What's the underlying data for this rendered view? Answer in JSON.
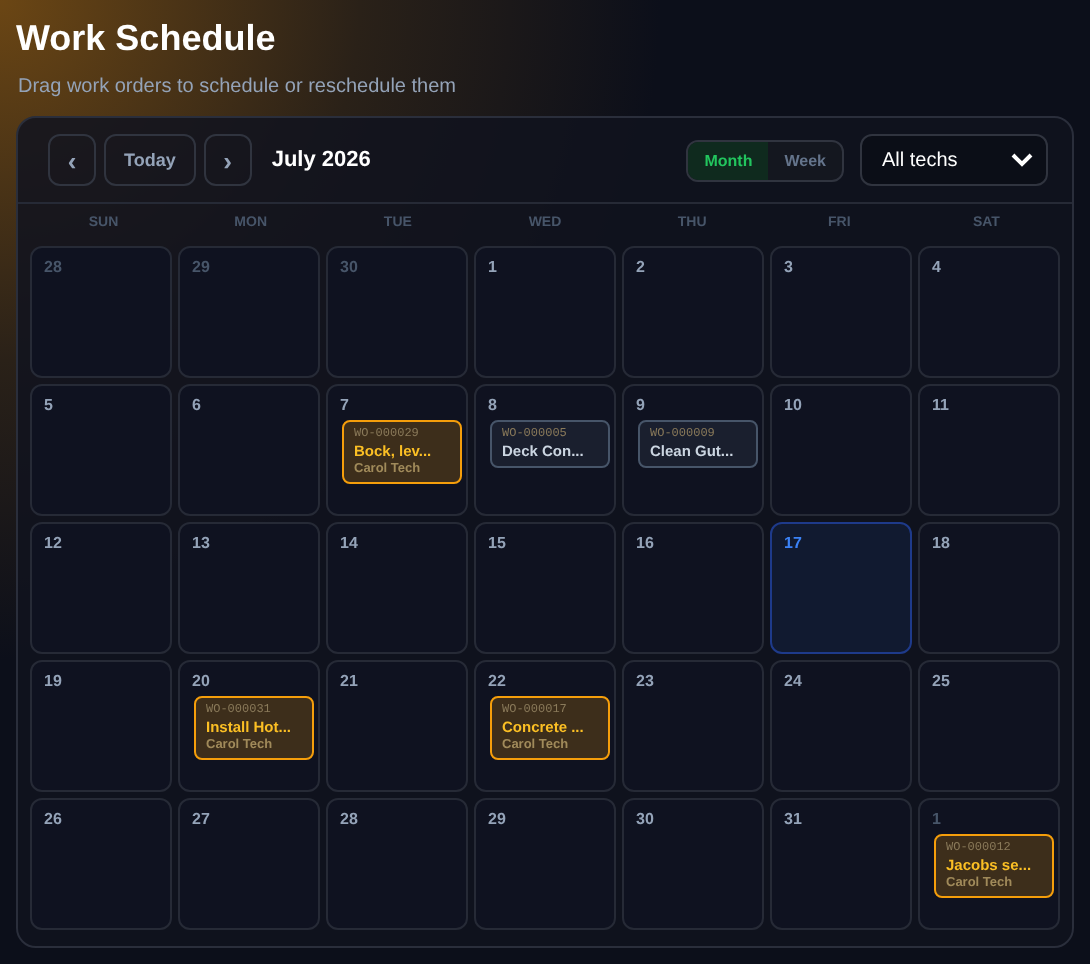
{
  "title": "Work Schedule",
  "subtitle": "Drag work orders to schedule or reschedule them",
  "toolbar": {
    "prev": "‹",
    "today": "Today",
    "next": "›",
    "month_label": "July 2026",
    "views": [
      {
        "label": "Month",
        "selected": true
      },
      {
        "label": "Week",
        "selected": false
      }
    ],
    "tech_filter": "All techs"
  },
  "weekdays": [
    "SUN",
    "MON",
    "TUE",
    "WED",
    "THU",
    "FRI",
    "SAT"
  ],
  "days": [
    {
      "day": "28",
      "outside": true,
      "today": false
    },
    {
      "day": "29",
      "outside": true,
      "today": false
    },
    {
      "day": "30",
      "outside": true,
      "today": false
    },
    {
      "day": "1",
      "outside": false,
      "today": false
    },
    {
      "day": "2",
      "outside": false,
      "today": false
    },
    {
      "day": "3",
      "outside": false,
      "today": false
    },
    {
      "day": "4",
      "outside": false,
      "today": false
    },
    {
      "day": "5",
      "outside": false,
      "today": false
    },
    {
      "day": "6",
      "outside": false,
      "today": false
    },
    {
      "day": "7",
      "outside": false,
      "today": false,
      "events": [
        {
          "id": "WO-000029",
          "title": "Bock, lev...",
          "tech": "Carol Tech",
          "color": "#f59e0b"
        }
      ]
    },
    {
      "day": "8",
      "outside": false,
      "today": false,
      "events": [
        {
          "id": "WO-000005",
          "title": "Deck Con...",
          "color": "#475569"
        }
      ]
    },
    {
      "day": "9",
      "outside": false,
      "today": false,
      "events": [
        {
          "id": "WO-000009",
          "title": "Clean Gut...",
          "color": "#475569"
        }
      ]
    },
    {
      "day": "10",
      "outside": false,
      "today": false
    },
    {
      "day": "11",
      "outside": false,
      "today": false
    },
    {
      "day": "12",
      "outside": false,
      "today": false
    },
    {
      "day": "13",
      "outside": false,
      "today": false
    },
    {
      "day": "14",
      "outside": false,
      "today": false
    },
    {
      "day": "15",
      "outside": false,
      "today": false
    },
    {
      "day": "16",
      "outside": false,
      "today": false
    },
    {
      "day": "17",
      "outside": false,
      "today": true
    },
    {
      "day": "18",
      "outside": false,
      "today": false
    },
    {
      "day": "19",
      "outside": false,
      "today": false
    },
    {
      "day": "20",
      "outside": false,
      "today": false,
      "events": [
        {
          "id": "WO-000031",
          "title": "Install Hot...",
          "tech": "Carol Tech",
          "color": "#f59e0b"
        }
      ]
    },
    {
      "day": "21",
      "outside": false,
      "today": false
    },
    {
      "day": "22",
      "outside": false,
      "today": false,
      "events": [
        {
          "id": "WO-000017",
          "title": "Concrete ...",
          "tech": "Carol Tech",
          "color": "#f59e0b"
        }
      ]
    },
    {
      "day": "23",
      "outside": false,
      "today": false
    },
    {
      "day": "24",
      "outside": false,
      "today": false
    },
    {
      "day": "25",
      "outside": false,
      "today": false
    },
    {
      "day": "26",
      "outside": false,
      "today": false
    },
    {
      "day": "27",
      "outside": false,
      "today": false
    },
    {
      "day": "28",
      "outside": false,
      "today": false
    },
    {
      "day": "29",
      "outside": false,
      "today": false
    },
    {
      "day": "30",
      "outside": false,
      "today": false
    },
    {
      "day": "31",
      "outside": false,
      "today": false
    },
    {
      "day": "1",
      "outside": true,
      "today": false,
      "events": [
        {
          "id": "WO-000012",
          "title": "Jacobs se...",
          "tech": "Carol Tech",
          "color": "#f59e0b"
        }
      ]
    }
  ]
}
